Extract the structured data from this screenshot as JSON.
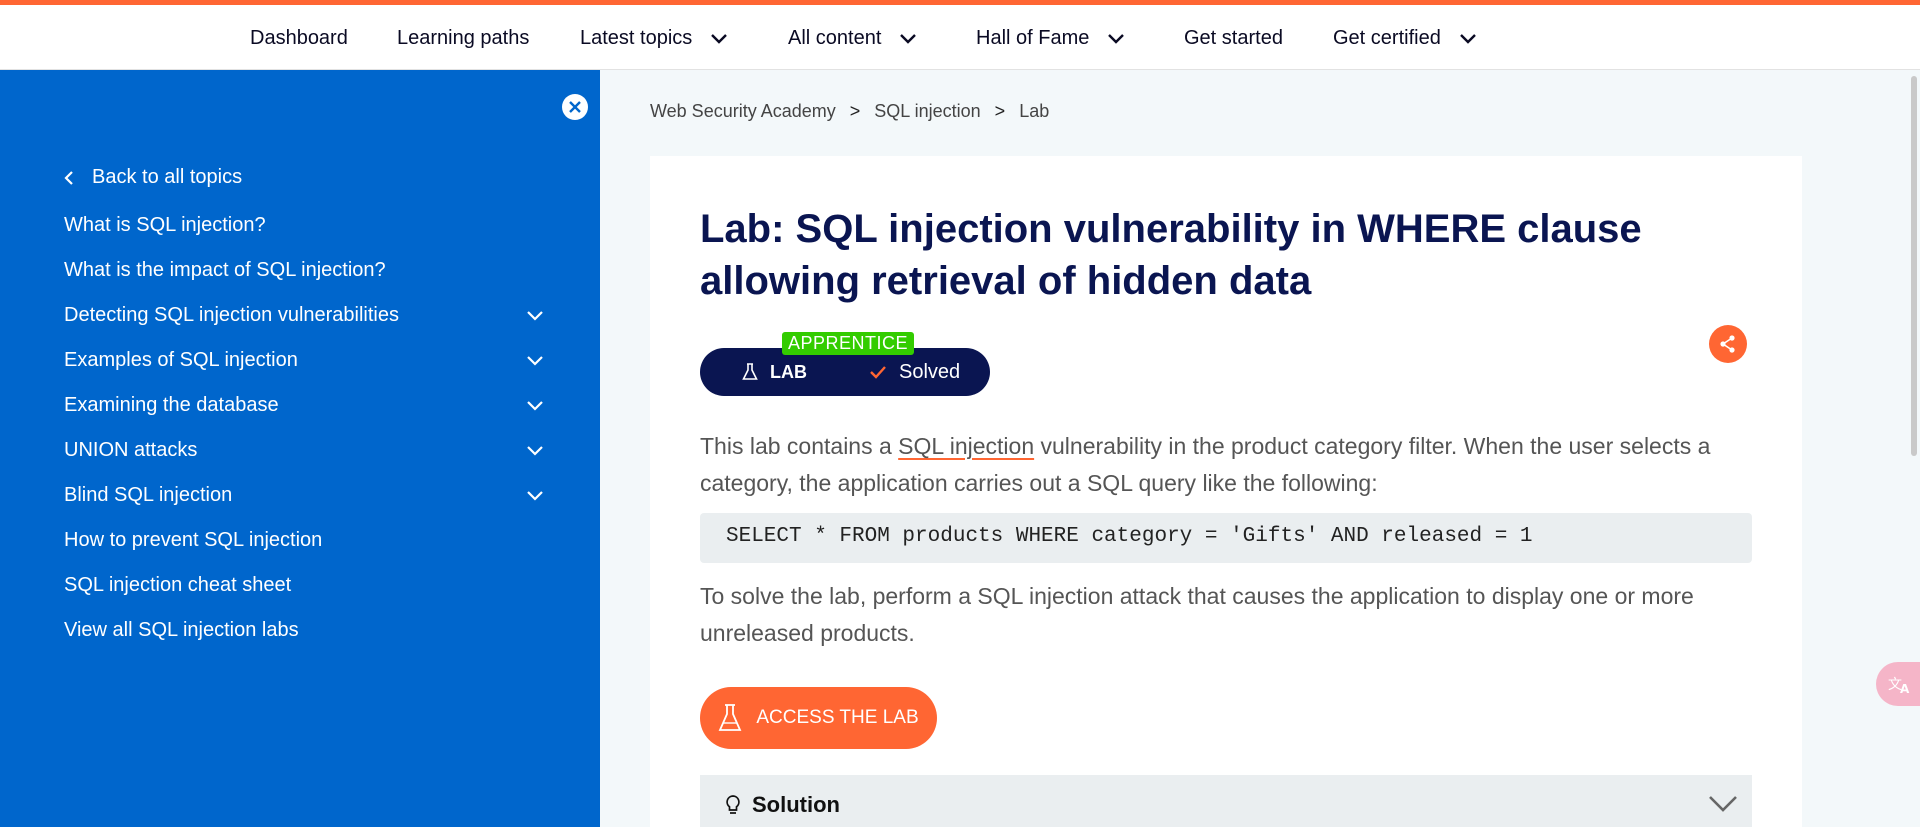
{
  "topnav": {
    "items": [
      {
        "label": "Dashboard",
        "has_dropdown": false
      },
      {
        "label": "Learning paths",
        "has_dropdown": false
      },
      {
        "label": "Latest topics",
        "has_dropdown": true
      },
      {
        "label": "All content",
        "has_dropdown": true
      },
      {
        "label": "Hall of Fame",
        "has_dropdown": true
      },
      {
        "label": "Get started",
        "has_dropdown": false
      },
      {
        "label": "Get certified",
        "has_dropdown": true
      }
    ]
  },
  "sidebar": {
    "back_label": "Back to all topics",
    "items": [
      {
        "label": "What is SQL injection?",
        "expandable": false
      },
      {
        "label": "What is the impact of SQL injection?",
        "expandable": false
      },
      {
        "label": "Detecting SQL injection vulnerabilities",
        "expandable": true
      },
      {
        "label": "Examples of SQL injection",
        "expandable": true
      },
      {
        "label": "Examining the database",
        "expandable": true
      },
      {
        "label": "UNION attacks",
        "expandable": true
      },
      {
        "label": "Blind SQL injection",
        "expandable": true
      },
      {
        "label": "How to prevent SQL injection",
        "expandable": false
      },
      {
        "label": "SQL injection cheat sheet",
        "expandable": false
      },
      {
        "label": "View all SQL injection labs",
        "expandable": false
      }
    ]
  },
  "breadcrumb": {
    "items": [
      "Web Security Academy",
      "SQL injection",
      "Lab"
    ],
    "separator": ">"
  },
  "lab": {
    "title": "Lab: SQL injection vulnerability in WHERE clause allowing retrieval of hidden data",
    "level": "APPRENTICE",
    "badge_label": "LAB",
    "status": "Solved",
    "intro_before_link": "This lab contains a ",
    "intro_link": "SQL injection",
    "intro_after_link": " vulnerability in the product category filter. When the user selects a category, the application carries out a SQL query like the following:",
    "code": "SELECT * FROM products WHERE category = 'Gifts' AND released = 1",
    "task": "To solve the lab, perform a SQL injection attack that causes the application to display one or more unreleased products.",
    "access_button": "ACCESS THE LAB",
    "solution_label": "Solution"
  },
  "colors": {
    "accent": "#ff6633",
    "sidebar": "#0066cc",
    "navy": "#0a1551",
    "level_green": "#33cc00"
  }
}
